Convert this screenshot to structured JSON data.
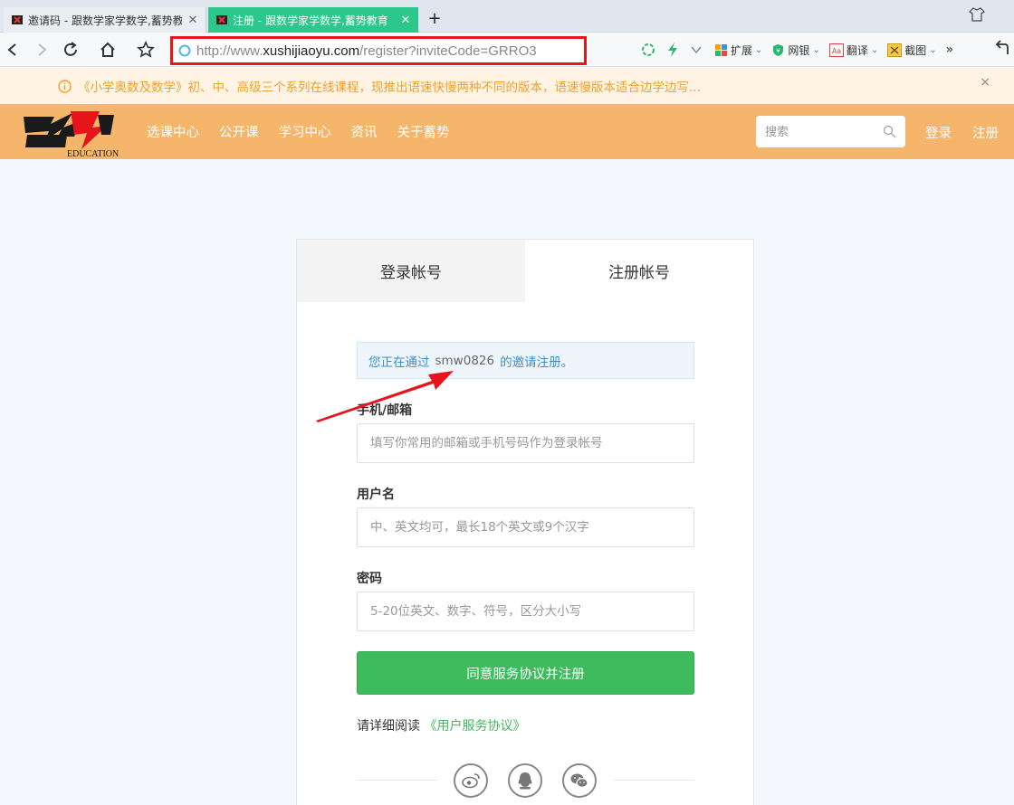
{
  "browser": {
    "tabs": [
      {
        "title": "邀请码 - 跟数学家学数学,蓄势教",
        "active": false
      },
      {
        "title": "注册 - 跟数学家学数学,蓄势教育",
        "active": true
      }
    ],
    "new_tab": "+",
    "close_glyph": "✕",
    "url_prefix": "http://www.",
    "url_domain": "xushijiaoyu.com",
    "url_path": "/register?inviteCode=GRRO3",
    "tools": {
      "extensions": "扩展",
      "bank": "网银",
      "translate": "翻译",
      "screenshot": "截图",
      "more": "»"
    }
  },
  "notice": {
    "text": "《小学奥数及数学》初、中、高级三个系列在线课程，现推出语速快慢两种不同的版本，语速慢版本适合边学边写...",
    "close": "×"
  },
  "header": {
    "logo_text": "EDUCATION",
    "nav": [
      "选课中心",
      "公开课",
      "学习中心",
      "资讯",
      "关于蓄势"
    ],
    "search_placeholder": "搜索",
    "login": "登录",
    "register": "注册"
  },
  "card": {
    "tab_login": "登录帐号",
    "tab_register": "注册帐号",
    "invite_prefix": "您正在通过",
    "invite_code": "smw0826",
    "invite_suffix": "的邀请注册。",
    "account_label": "手机/邮箱",
    "account_placeholder": "填写你常用的邮箱或手机号码作为登录帐号",
    "username_label": "用户名",
    "username_placeholder": "中、英文均可，最长18个英文或9个汉字",
    "password_label": "密码",
    "password_placeholder": "5-20位英文、数字、符号，区分大小写",
    "submit": "同意服务协议并注册",
    "agreement_prefix": "请详细阅读",
    "agreement_link": "《用户服务协议》"
  },
  "colors": {
    "header_bg": "#f5b56a",
    "notice_text": "#f0a030",
    "active_tab": "#2cc78a",
    "submit_bg": "#3dbb5d",
    "invite_text": "#3b8ed0",
    "annotation_red": "#e8141c"
  },
  "icons": {
    "social": [
      "weibo-icon",
      "qq-icon",
      "wechat-icon"
    ]
  }
}
